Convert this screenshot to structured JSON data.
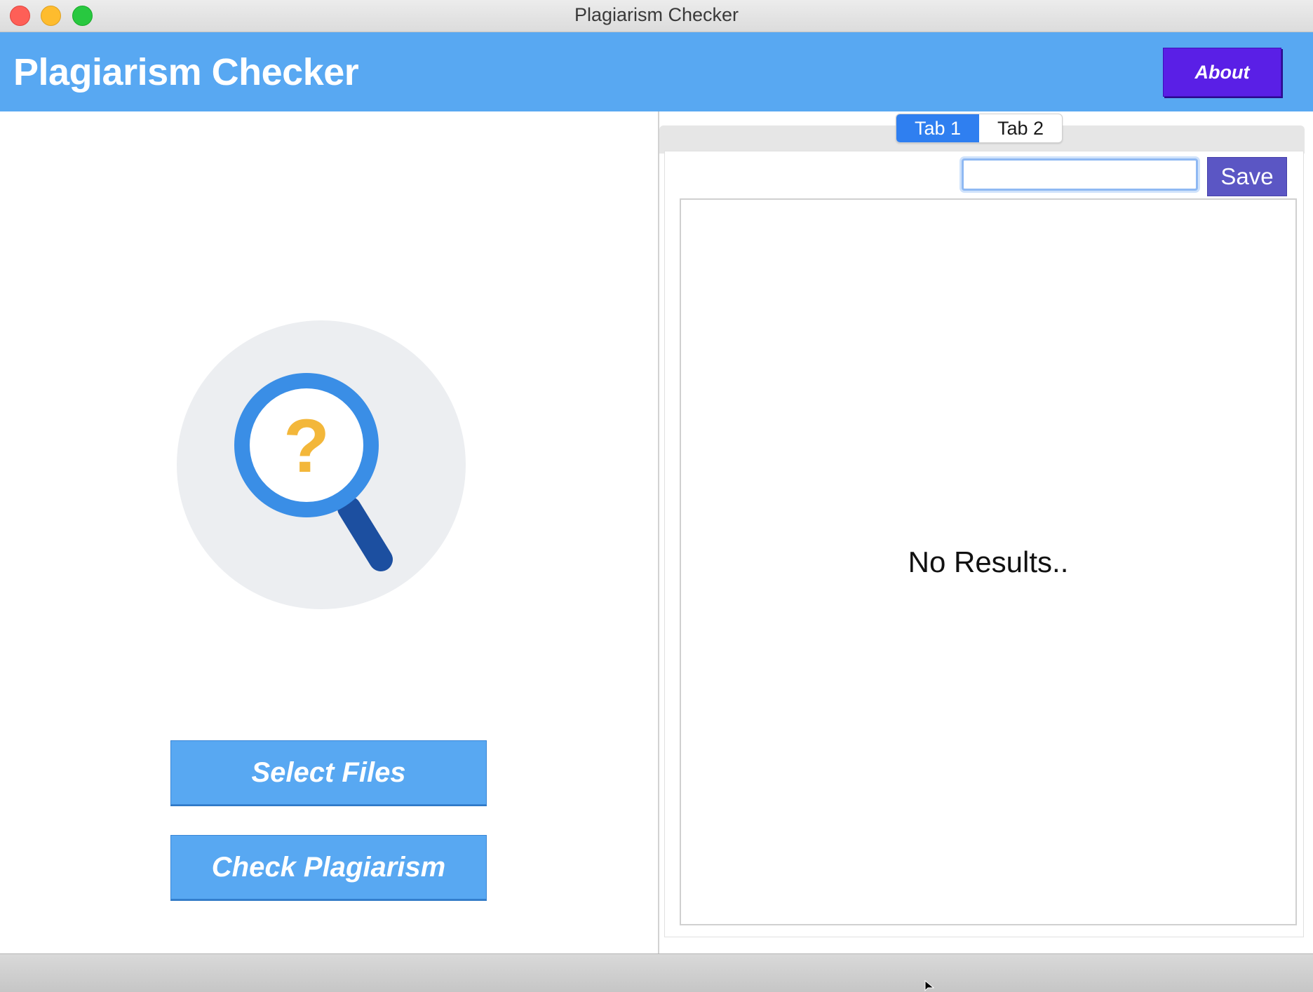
{
  "window": {
    "title": "Plagiarism Checker"
  },
  "header": {
    "title": "Plagiarism Checker",
    "about_label": "About"
  },
  "left": {
    "illustration_icon": "magnifier-question-icon",
    "question_mark": "?",
    "select_files_label": "Select Files",
    "check_plagiarism_label": "Check Plagiarism"
  },
  "right": {
    "tabs": [
      {
        "label": "Tab 1",
        "active": true
      },
      {
        "label": "Tab 2",
        "active": false
      }
    ],
    "save_input_value": "",
    "save_label": "Save",
    "empty_message": "No Results.."
  },
  "colors": {
    "header_bg": "#58a8f2",
    "about_bg": "#5a1fe6",
    "save_bg": "#5b56c4",
    "active_tab": "#2f7ff0",
    "icon_blue": "#3a8ee6",
    "icon_handle": "#1c4fa0",
    "question_yellow": "#f3b73a"
  }
}
